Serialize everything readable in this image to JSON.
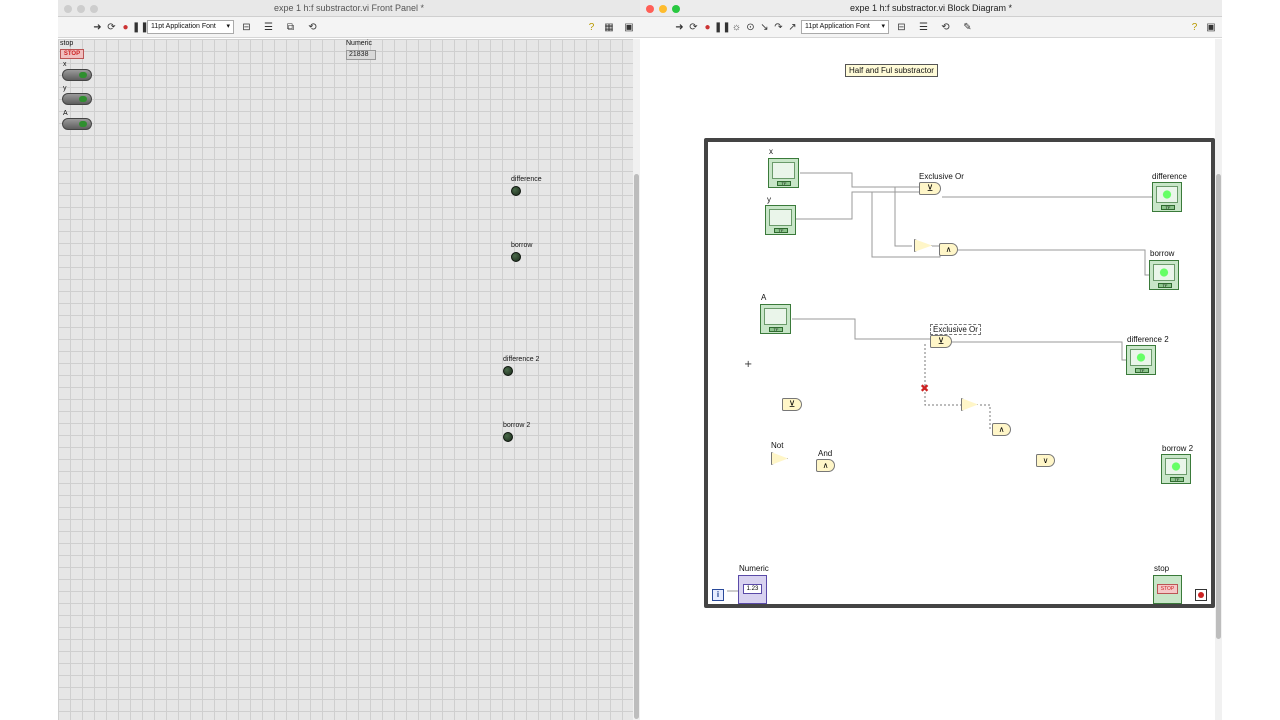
{
  "front_panel": {
    "window_title": "expe 1 h:f substractor.vi Front Panel *",
    "toolbar": {
      "font": "11pt Application Font"
    },
    "controls": {
      "stop_label": "stop",
      "stop_button_text": "STOP",
      "x_label": "x",
      "y_label": "y",
      "a_label": "A",
      "numeric_label": "Numeric",
      "numeric_value": "21838"
    },
    "indicators": {
      "difference": "difference",
      "borrow": "borrow",
      "difference2": "difference 2",
      "borrow2": "borrow 2"
    }
  },
  "block_diagram": {
    "window_title": "expe 1 h:f substractor.vi Block Diagram *",
    "toolbar": {
      "font": "11pt Application Font"
    },
    "free_label": "Half and Ful substractor",
    "nodes": {
      "x": "x",
      "y": "y",
      "a": "A",
      "xor1": "Exclusive Or",
      "xor2": "Exclusive Or",
      "difference": "difference",
      "borrow": "borrow",
      "difference2": "difference 2",
      "borrow2": "borrow 2",
      "not": "Not",
      "and": "And",
      "numeric": "Numeric",
      "numeric_terminal": "1.23",
      "stop": "stop",
      "stop_terminal": "STOP",
      "iteration": "i"
    },
    "gate_symbols": {
      "xor": "⊻",
      "and": "∧",
      "or": "∨",
      "not": "▷"
    }
  },
  "colors": {
    "terminal_green": "#3a7a3a",
    "wire": "#9a9a9a",
    "loop_border": "#444444",
    "gate_fill": "#fff6c8",
    "stop_red": "#cc2222"
  }
}
